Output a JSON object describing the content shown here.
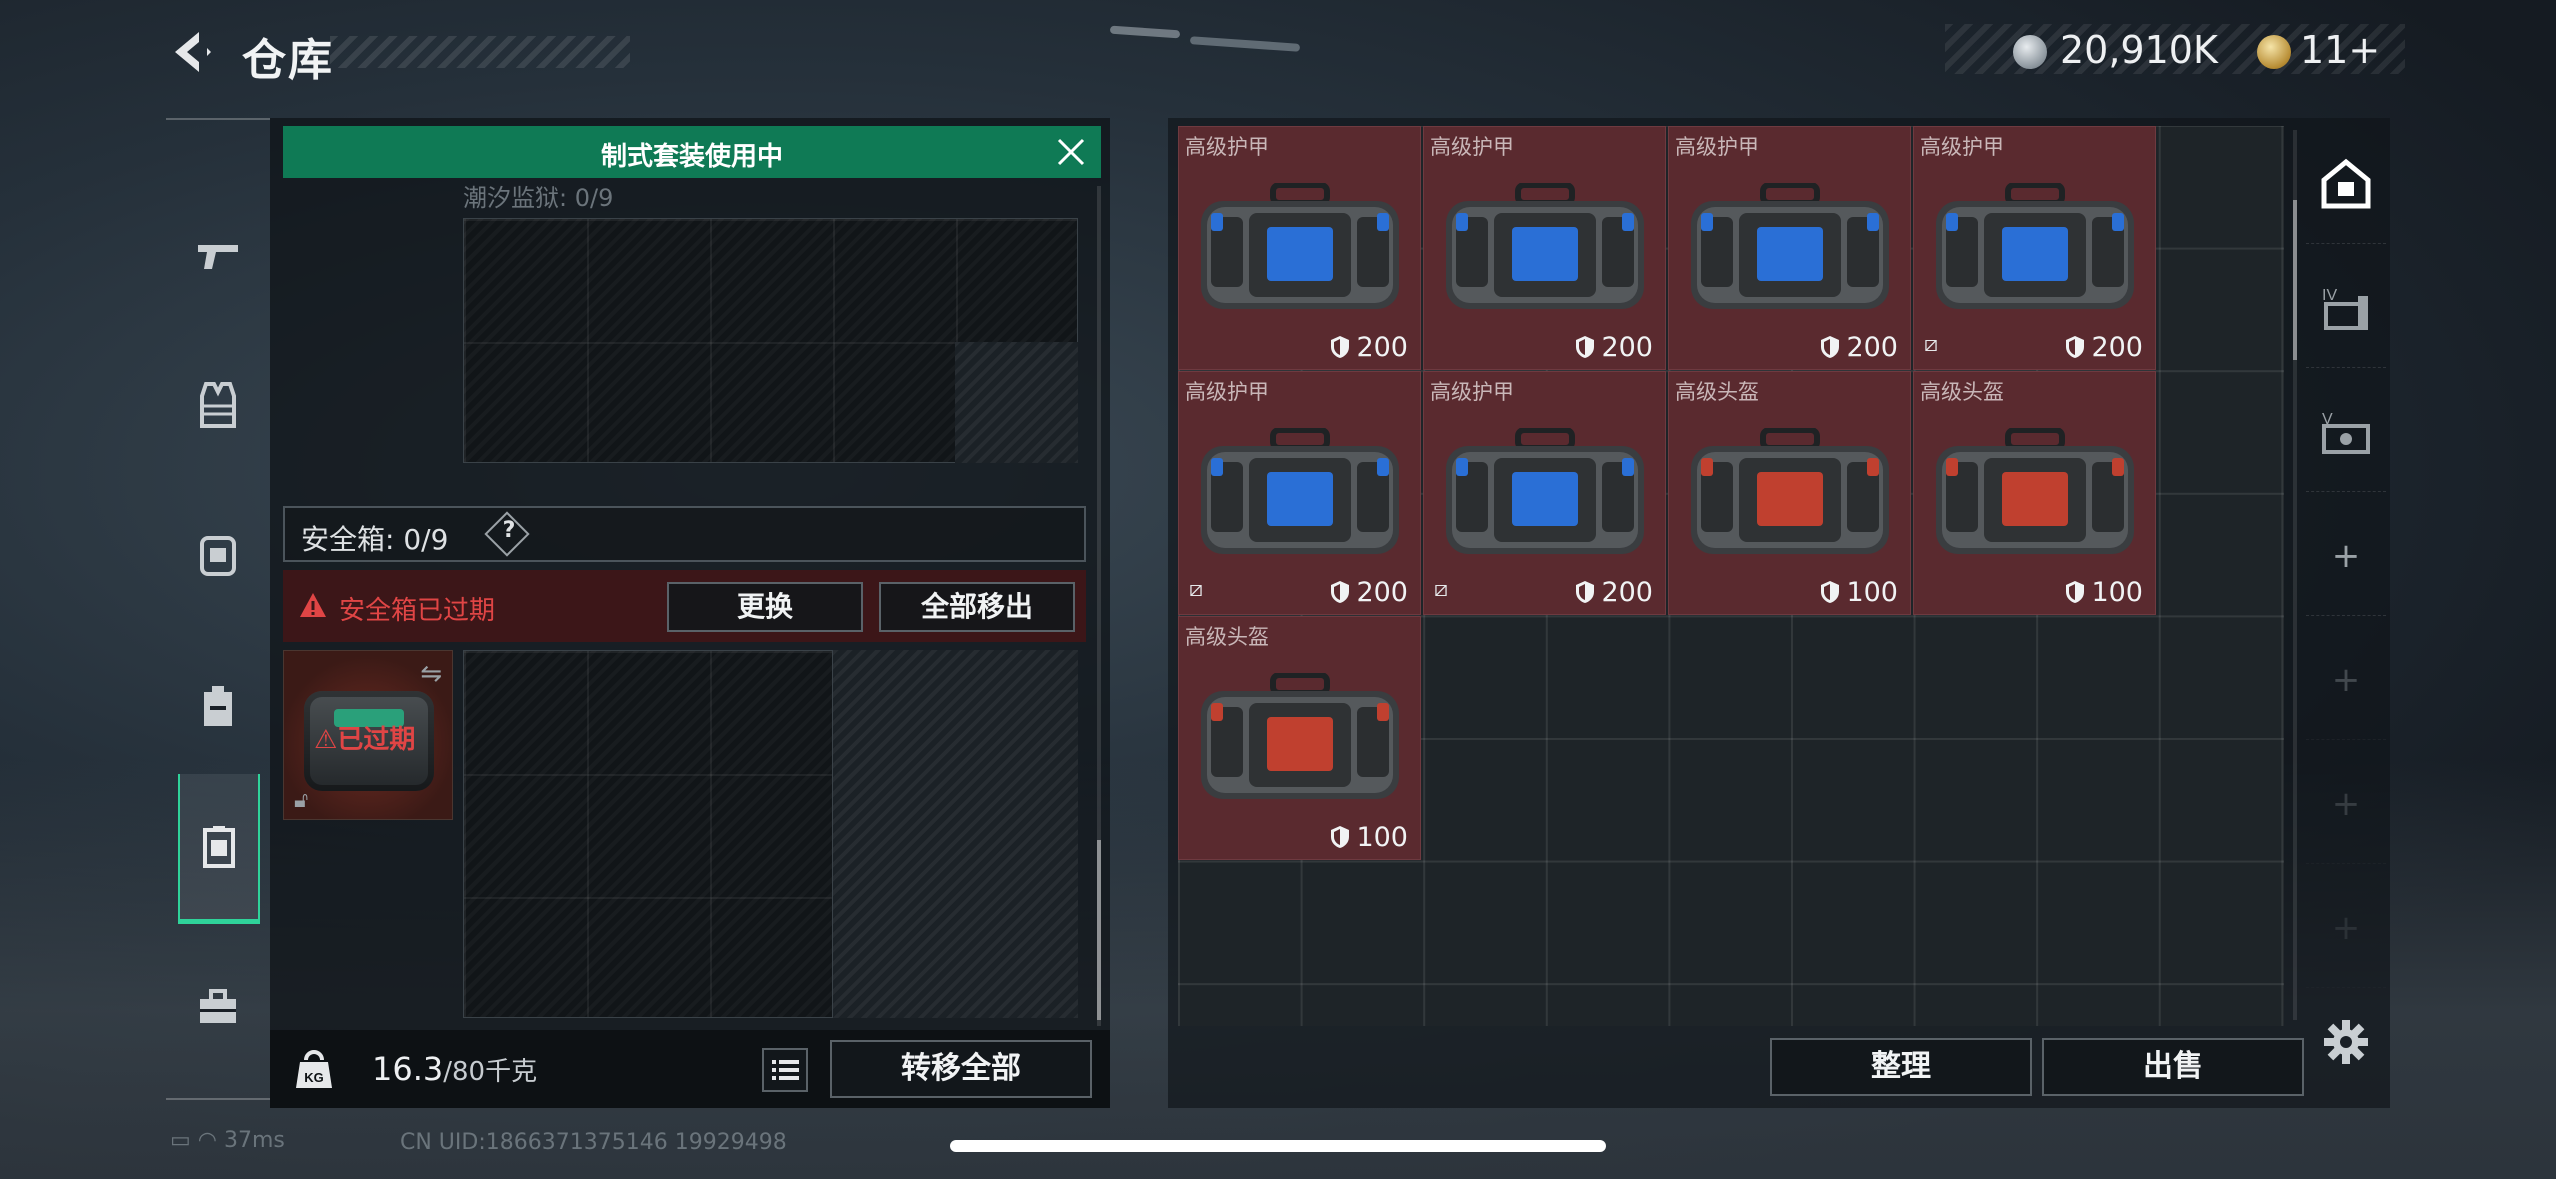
{
  "header": {
    "title": "仓库",
    "currency_value": "20,910K",
    "token_value": "11+"
  },
  "left_panel": {
    "kit_banner": "制式套装使用中",
    "tidal_label": "潮汐监狱: 0/9",
    "safebox_label": "安全箱: 0/9",
    "help_label": "?",
    "expired_warning": "安全箱已过期",
    "swap_button": "更换",
    "move_all_button": "全部移出",
    "case_status": "已过期",
    "weight_current": "16.3",
    "weight_max": "/80千克",
    "transfer_all_button": "转移全部"
  },
  "storage": {
    "items": [
      {
        "name": "高级护甲",
        "durability": "200",
        "color": "#2a6fd6",
        "broken": false
      },
      {
        "name": "高级护甲",
        "durability": "200",
        "color": "#2a6fd6",
        "broken": false
      },
      {
        "name": "高级护甲",
        "durability": "200",
        "color": "#2a6fd6",
        "broken": false
      },
      {
        "name": "高级护甲",
        "durability": "200",
        "color": "#2a6fd6",
        "broken": true
      },
      {
        "name": "高级护甲",
        "durability": "200",
        "color": "#2a6fd6",
        "broken": true
      },
      {
        "name": "高级护甲",
        "durability": "200",
        "color": "#2a6fd6",
        "broken": true
      },
      {
        "name": "高级头盔",
        "durability": "100",
        "color": "#c0402f",
        "broken": false
      },
      {
        "name": "高级头盔",
        "durability": "100",
        "color": "#c0402f",
        "broken": false
      },
      {
        "name": "高级头盔",
        "durability": "100",
        "color": "#c0402f",
        "broken": false
      }
    ],
    "organize_button": "整理",
    "sell_button": "出售"
  },
  "rails": {
    "left": [
      "gun-icon",
      "vest-icon",
      "rig-icon",
      "backpack-icon",
      "safebox-icon",
      "briefcase-icon"
    ],
    "right": [
      "home-icon",
      "storage-iv-icon",
      "storage-v-icon",
      "plus-icon",
      "plus-icon",
      "plus-icon",
      "plus-icon"
    ],
    "plus": "+"
  },
  "status": {
    "ping": "37ms",
    "uid": "CN UID:1866371375146 19929498"
  },
  "colors": {
    "accent": "#0f7a55",
    "active": "#2fd39a",
    "danger": "#e04545",
    "item_bg": "#5a2a2f"
  }
}
